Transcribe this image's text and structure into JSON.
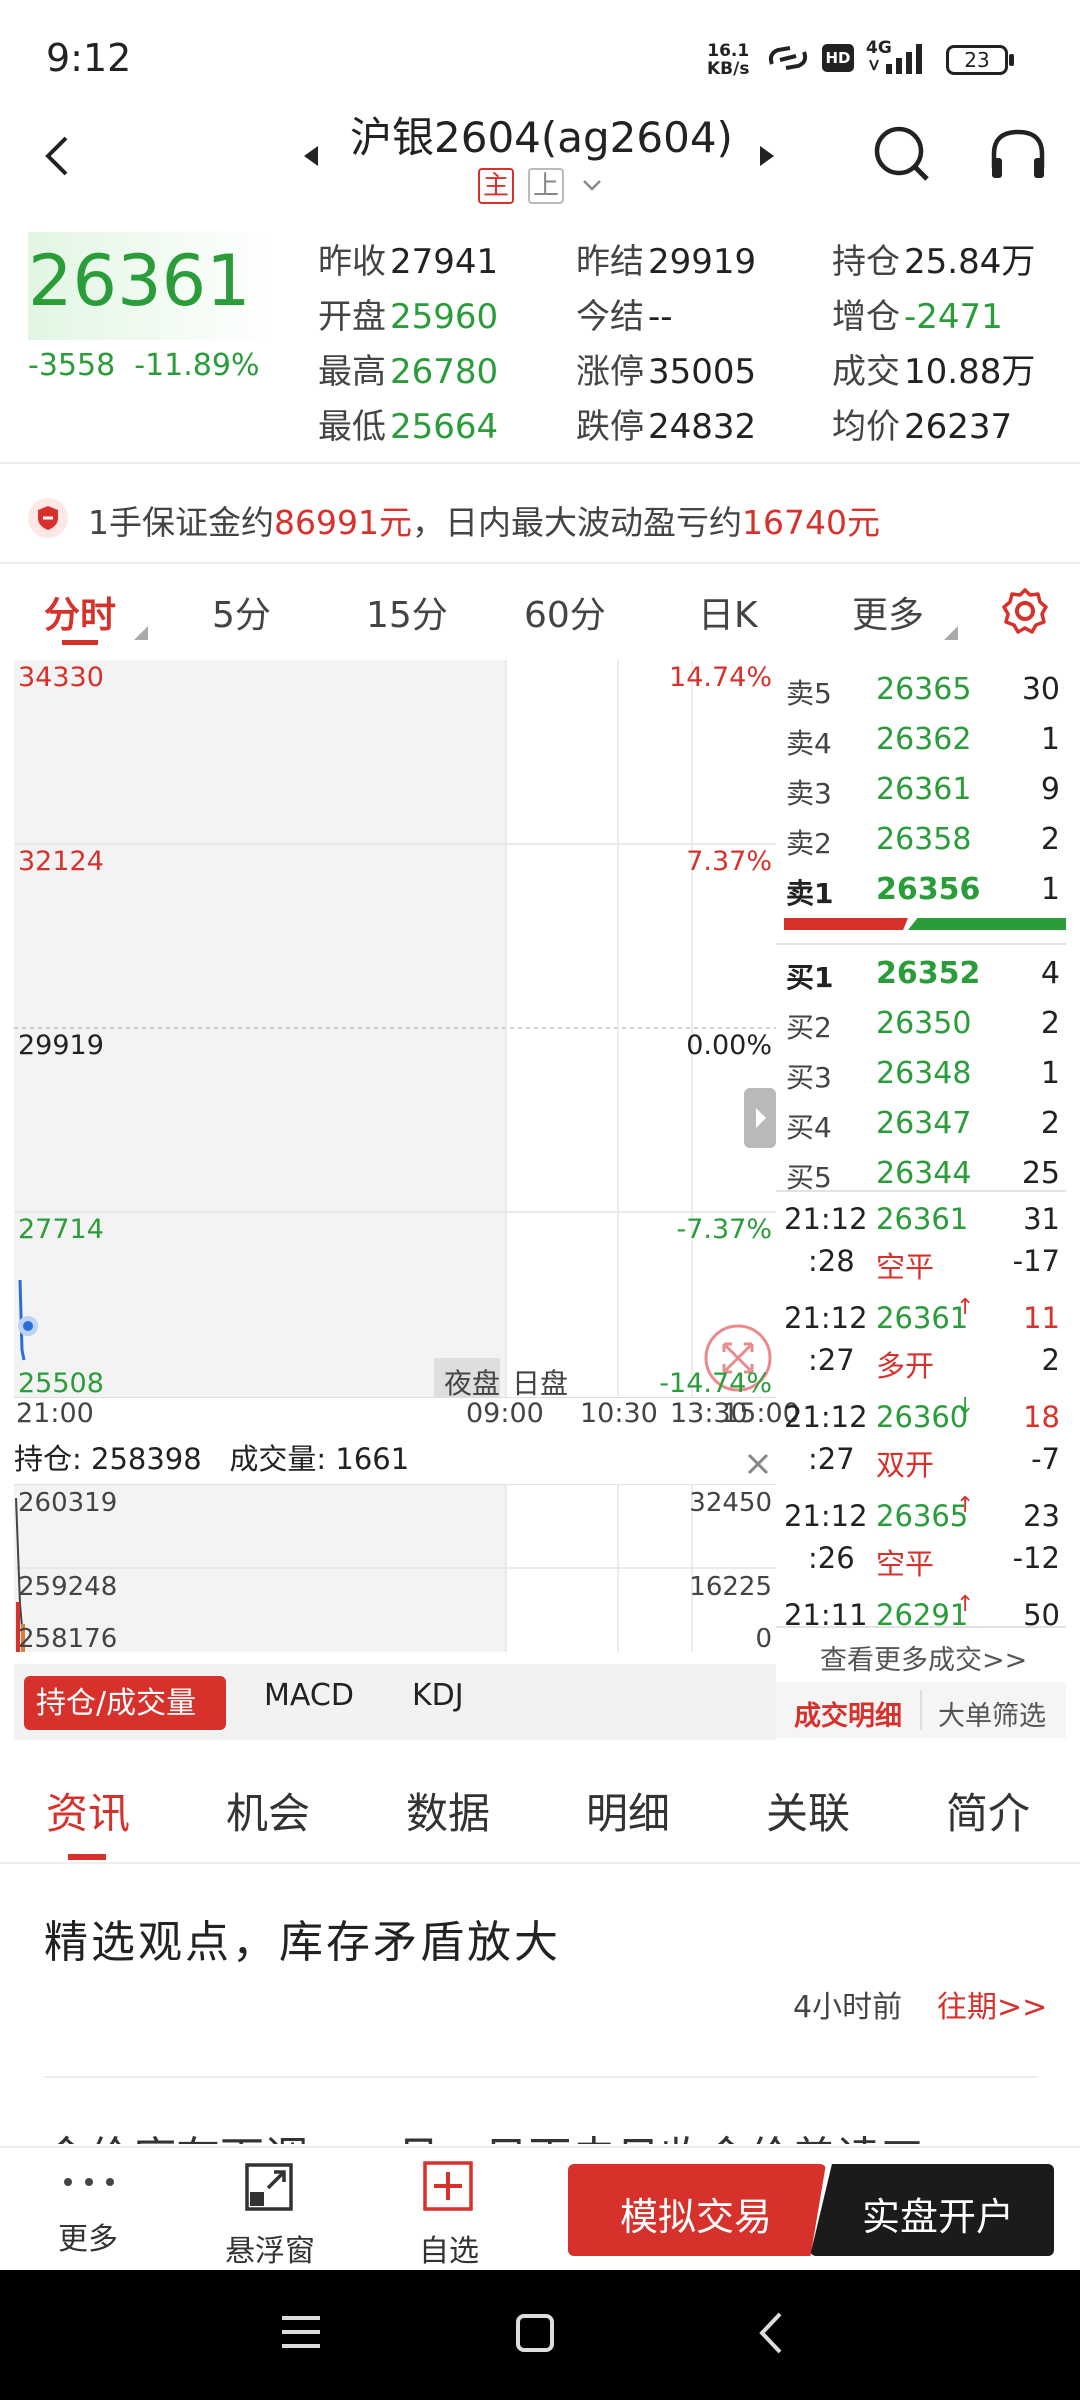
{
  "status_bar": {
    "time": "9:12",
    "speed_value": "16.1",
    "speed_unit": "KB/s",
    "hd": "HD",
    "network": "4G",
    "battery": "23"
  },
  "header": {
    "title": "沪银2604(ag2604)",
    "badge_main": "主",
    "badge_up": "上"
  },
  "quote": {
    "last": "26361",
    "change": "-3558",
    "change_pct": "-11.89%",
    "stats": [
      {
        "label": "昨收",
        "value": "27941",
        "color": "#222222"
      },
      {
        "label": "开盘",
        "value": "25960",
        "color": "#2a9d3a"
      },
      {
        "label": "最高",
        "value": "26780",
        "color": "#2a9d3a"
      },
      {
        "label": "最低",
        "value": "25664",
        "color": "#2a9d3a"
      },
      {
        "label": "昨结",
        "value": "29919",
        "color": "#222222"
      },
      {
        "label": "今结",
        "value": "--",
        "color": "#222222"
      },
      {
        "label": "涨停",
        "value": "35005",
        "color": "#222222"
      },
      {
        "label": "跌停",
        "value": "24832",
        "color": "#222222"
      },
      {
        "label": "持仓",
        "value": "25.84万",
        "color": "#222222"
      },
      {
        "label": "增仓",
        "value": "-2471",
        "color": "#2a9d3a"
      },
      {
        "label": "成交",
        "value": "10.88万",
        "color": "#222222"
      },
      {
        "label": "均价",
        "value": "26237",
        "color": "#222222"
      }
    ]
  },
  "margin": {
    "prefix": "1手保证金约",
    "margin_value": "86991元",
    "middle": "，日内最大波动盈亏约",
    "swing_value": "16740元"
  },
  "chart_tabs": [
    "分时",
    "5分",
    "15分",
    "60分",
    "日K",
    "更多"
  ],
  "chart": {
    "price_labels": [
      "34330",
      "32124",
      "29919",
      "27714",
      "25508"
    ],
    "pct_labels": [
      "14.74%",
      "7.37%",
      "0.00%",
      "-7.37%",
      "-14.74%"
    ],
    "session_night": "夜盘",
    "session_day": "日盘",
    "time_labels": [
      "21:00",
      "09:00",
      "10:30",
      "13:30",
      "15:00"
    ],
    "oi_label": "持仓:",
    "oi_value": "258398",
    "vol_label": "成交量:",
    "vol_value": "1661",
    "oi_axis": [
      "260319",
      "259248",
      "258176"
    ],
    "vol_axis": [
      "32450",
      "16225",
      "0"
    ]
  },
  "order_book": {
    "asks": [
      {
        "label": "卖5",
        "price": "26365",
        "qty": "30"
      },
      {
        "label": "卖4",
        "price": "26362",
        "qty": "1"
      },
      {
        "label": "卖3",
        "price": "26361",
        "qty": "9"
      },
      {
        "label": "卖2",
        "price": "26358",
        "qty": "2"
      },
      {
        "label": "卖1",
        "price": "26356",
        "qty": "1"
      }
    ],
    "bids": [
      {
        "label": "买1",
        "price": "26352",
        "qty": "4"
      },
      {
        "label": "买2",
        "price": "26350",
        "qty": "2"
      },
      {
        "label": "买3",
        "price": "26348",
        "qty": "1"
      },
      {
        "label": "买4",
        "price": "26347",
        "qty": "2"
      },
      {
        "label": "买5",
        "price": "26344",
        "qty": "25"
      }
    ],
    "deals": [
      {
        "time": "21:12",
        "sec": ":28",
        "price": "26361",
        "arrow": "",
        "vol": "31",
        "vol_color": "#222222",
        "type": "空平",
        "type_color": "#d7312c",
        "oi": "-17"
      },
      {
        "time": "21:12",
        "sec": ":27",
        "price": "26361",
        "arrow": "↑",
        "vol": "11",
        "vol_color": "#d7312c",
        "type": "多开",
        "type_color": "#d7312c",
        "oi": "2"
      },
      {
        "time": "21:12",
        "sec": ":27",
        "price": "26360",
        "arrow": "↓",
        "vol": "18",
        "vol_color": "#d7312c",
        "type": "双开",
        "type_color": "#d7312c",
        "oi": "-7"
      },
      {
        "time": "21:12",
        "sec": ":26",
        "price": "26365",
        "arrow": "↑",
        "vol": "23",
        "vol_color": "#222222",
        "type": "空平",
        "type_color": "#d7312c",
        "oi": "-12"
      },
      {
        "time": "21:11",
        "sec": "",
        "price": "26291",
        "arrow": "↑",
        "vol": "50",
        "vol_color": "#222222",
        "type": "",
        "type_color": "#222222",
        "oi": ""
      }
    ],
    "more_link": "查看更多成交>>",
    "tab_detail": "成交明细",
    "tab_filter": "大单筛选"
  },
  "indicator_tabs": [
    "持仓/成交量",
    "MACD",
    "KDJ"
  ],
  "news_tabs": [
    "资讯",
    "机会",
    "数据",
    "明细",
    "关联",
    "简介"
  ],
  "news": {
    "headline": "精选观点，库存矛盾放大",
    "time_ago": "4小时前",
    "past_link": "往期>>",
    "next_headline": "金价库存下调，一月；日丙夫日收金价盖读工"
  },
  "action_bar": {
    "more": "更多",
    "float": "悬浮窗",
    "watch": "自选",
    "sim_trade": "模拟交易",
    "real_account": "实盘开户"
  }
}
